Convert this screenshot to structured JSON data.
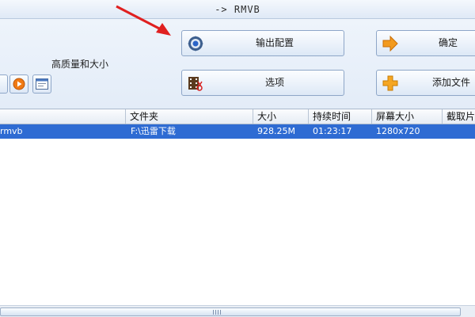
{
  "window": {
    "title": "-> RMVB"
  },
  "toolbar": {
    "quality_text": "高质量和大小",
    "output_config_label": "输出配置",
    "confirm_label": "确定",
    "options_label": "选项",
    "add_file_label": "添加文件"
  },
  "table": {
    "columns": [
      "文件夹",
      "大小",
      "持续时间",
      "屏幕大小",
      "截取片"
    ],
    "rows": [
      {
        "name": "rmvb",
        "folder": "F:\\迅雷下载",
        "size": "928.25M",
        "duration": "01:23:17",
        "screen_size": "1280x720",
        "clip": ""
      }
    ]
  },
  "colors": {
    "selection": "#2e6bd3",
    "annotation_arrow": "#e02020"
  },
  "icons": [
    "gear-icon",
    "arrow-right-icon",
    "film-scissors-icon",
    "plus-icon",
    "play-icon",
    "window-icon"
  ]
}
